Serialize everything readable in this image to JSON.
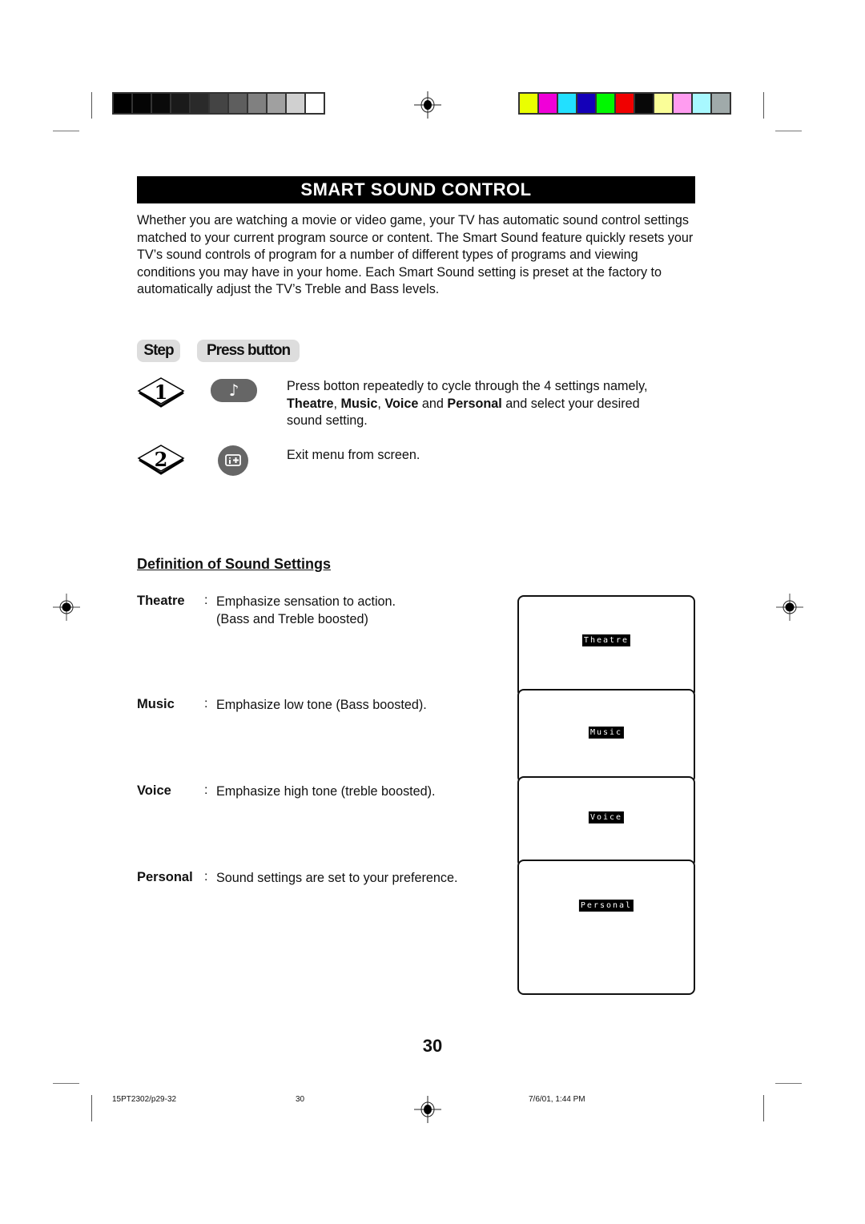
{
  "print_marks": {
    "grayscale_swatches": [
      "#000000",
      "#050505",
      "#0a0a0a",
      "#1a1a1a",
      "#2a2a2a",
      "#444444",
      "#5e5e5e",
      "#808080",
      "#a0a0a0",
      "#d0d0d0",
      "#ffffff"
    ],
    "color_swatches": [
      "#eaff00",
      "#f000d8",
      "#22e0ff",
      "#1400b8",
      "#00f800",
      "#f00000",
      "#080808",
      "#fafe98",
      "#ff9cf0",
      "#a8f8ff",
      "#a0aaaa"
    ]
  },
  "header": {
    "title_parts": [
      {
        "big": "S",
        "small": "MART"
      },
      {
        "big": "S",
        "small": "OUND"
      },
      {
        "big": "C",
        "small": "ONTROL"
      }
    ]
  },
  "intro": {
    "text": "Whether you are watching a movie or video game, your TV has automatic sound control settings matched to your current program source or content. The Smart Sound feature quickly resets your TV’s sound controls of program for a number of different types of programs and viewing conditions you may have in your home. Each Smart Sound setting is preset at the factory to automatically adjust the TV’s Treble and Bass levels."
  },
  "steps_table": {
    "col_step": "Step",
    "col_press": "Press button",
    "steps": [
      {
        "number": "1",
        "button_icon": "music-note-icon",
        "button_glyph": "♪",
        "text_intro": "Press botton repeatedly to cycle through the 4 settings namely,",
        "settings": [
          "Theatre",
          "Music",
          "Voice",
          "Personal"
        ],
        "text_sep1": ", ",
        "text_sep2": ", ",
        "text_and": " and ",
        "text_outro": " and select your desired sound setting."
      },
      {
        "number": "2",
        "button_icon": "info-plus-icon",
        "text": "Exit menu from screen."
      }
    ]
  },
  "definitions": {
    "heading": "Definition of Sound Settings",
    "colon": ":",
    "items": [
      {
        "term": "Theatre",
        "desc": "Emphasize sensation to action.",
        "desc2": "(Bass and Treble boosted)"
      },
      {
        "term": "Music",
        "desc": "Emphasize low tone (Bass boosted)."
      },
      {
        "term": "Voice",
        "desc": "Emphasize high tone (treble boosted)."
      },
      {
        "term": "Personal",
        "desc": "Sound settings are set to your preference."
      }
    ]
  },
  "screens": [
    {
      "osd_label": "Theatre"
    },
    {
      "osd_label": "Music"
    },
    {
      "osd_label": "Voice"
    },
    {
      "osd_label": "Personal"
    }
  ],
  "page_number": "30",
  "footer": {
    "file": "15PT2302/p29-32",
    "page": "30",
    "timestamp": "7/6/01, 1:44 PM"
  }
}
